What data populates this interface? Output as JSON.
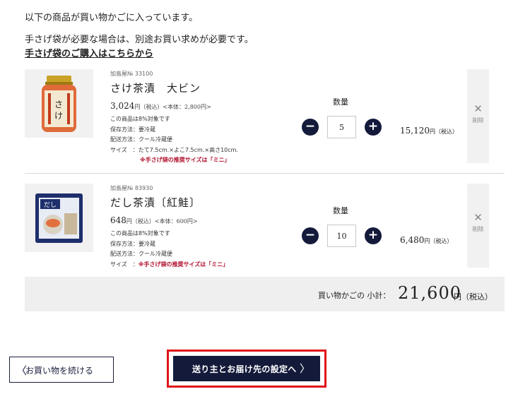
{
  "intro": {
    "line1": "以下の商品が買い物かごに入っています。",
    "line2": "手さげ袋が必要な場合は、別途お買い求めが必要です。",
    "link": "手さげ袋のご購入はこちらから"
  },
  "qty_label": "数量",
  "tax_incl_small": "（税込）",
  "delete_label": "削除",
  "items": [
    {
      "code": "加島屋№ 33100",
      "name": "さけ茶漬　大ビン",
      "price": "3,024",
      "price_unit": "円（税込）",
      "base_price": "<本体：2,800円>",
      "tax_note": "この商品は8%対象です",
      "storage": "保存方法：要冷蔵",
      "delivery": "配送方法：クール冷蔵便",
      "size": "サイズ　：たて7.5cm.×よこ7.5cm.×高さ10cm.",
      "bag_note": "※手さげ袋の推奨サイズは「ミニ」",
      "qty": "5",
      "line_total": "15,120",
      "line_total_unit": "円（税込）"
    },
    {
      "code": "加島屋№ 83930",
      "name": "だし茶漬〔紅鮭〕",
      "price": "648",
      "price_unit": "円（税込）",
      "base_price": "<本体：600円>",
      "tax_note": "この商品は8%対象です",
      "storage": "保存方法：要冷蔵",
      "delivery": "配送方法：クール冷蔵便",
      "size_label": "サイズ　：",
      "bag_note": "※手さげ袋の推奨サイズは「ミニ」",
      "qty": "10",
      "line_total": "6,480",
      "line_total_unit": "円（税込）"
    }
  ],
  "subtotal": {
    "label": "買い物かごの 小計：",
    "amount": "21,600",
    "unit": "円（税込）"
  },
  "buttons": {
    "continue": "お買い物を続ける",
    "checkout": "送り主とお届け先の設定へ"
  },
  "icons": {
    "minus": "−",
    "plus": "+",
    "delete": "✕",
    "chevron_left": "〈",
    "chevron_right": "〉"
  },
  "colors": {
    "navy": "#141a3a",
    "warning_red": "#b0112d",
    "highlight_red": "#e0141b"
  }
}
